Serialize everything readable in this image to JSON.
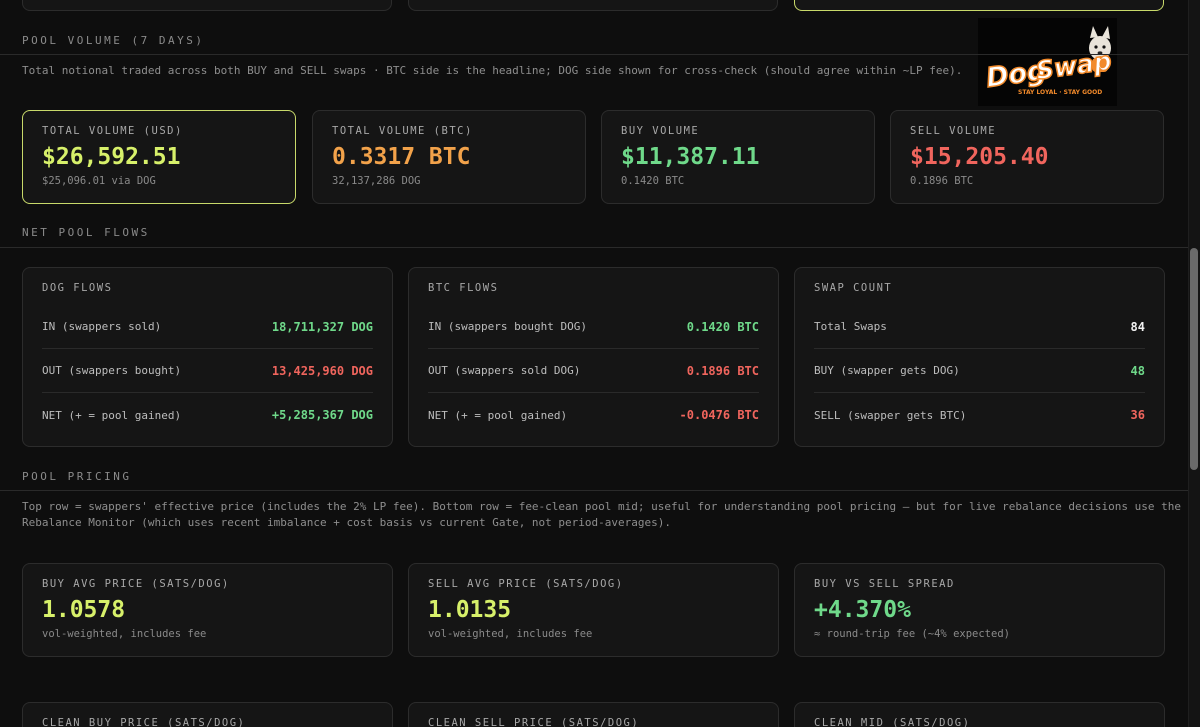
{
  "pool_volume": {
    "title": "POOL VOLUME (7 DAYS)",
    "description": "Total notional traded across both BUY and SELL swaps · BTC side is the headline; DOG side shown for cross-check (should agree within ~LP fee).",
    "cards": [
      {
        "label": "TOTAL VOLUME (USD)",
        "value": "$26,592.51",
        "sub": "$25,096.01 via DOG"
      },
      {
        "label": "TOTAL VOLUME (BTC)",
        "value": "0.3317 BTC",
        "sub": "32,137,286 DOG"
      },
      {
        "label": "BUY VOLUME",
        "value": "$11,387.11",
        "sub": "0.1420 BTC"
      },
      {
        "label": "SELL VOLUME",
        "value": "$15,205.40",
        "sub": "0.1896 BTC"
      }
    ]
  },
  "net_flows": {
    "title": "NET POOL FLOWS",
    "dog": {
      "title": "DOG FLOWS",
      "rows": [
        {
          "label": "IN (swappers sold)",
          "value": "18,711,327 DOG"
        },
        {
          "label": "OUT (swappers bought)",
          "value": "13,425,960 DOG"
        },
        {
          "label": "NET (+ = pool gained)",
          "value": "+5,285,367 DOG"
        }
      ]
    },
    "btc": {
      "title": "BTC FLOWS",
      "rows": [
        {
          "label": "IN (swappers bought DOG)",
          "value": "0.1420 BTC"
        },
        {
          "label": "OUT (swappers sold DOG)",
          "value": "0.1896 BTC"
        },
        {
          "label": "NET (+ = pool gained)",
          "value": "-0.0476 BTC"
        }
      ]
    },
    "count": {
      "title": "SWAP COUNT",
      "rows": [
        {
          "label": "Total Swaps",
          "value": "84"
        },
        {
          "label": "BUY (swapper gets DOG)",
          "value": "48"
        },
        {
          "label": "SELL (swapper gets BTC)",
          "value": "36"
        }
      ]
    }
  },
  "pricing": {
    "title": "POOL PRICING",
    "description_1": "Top row = swappers' effective price (includes the 2% LP fee). Bottom row = fee-clean pool mid; useful for understanding pool pricing — but for live rebalance decisions use the",
    "description_2": "Rebalance Monitor (which uses recent imbalance + cost basis vs current Gate, not period-averages).",
    "cards": [
      {
        "label": "BUY AVG PRICE (SATS/DOG)",
        "value": "1.0578",
        "sub": "vol-weighted, includes fee"
      },
      {
        "label": "SELL AVG PRICE (SATS/DOG)",
        "value": "1.0135",
        "sub": "vol-weighted, includes fee"
      },
      {
        "label": "BUY VS SELL SPREAD",
        "value": "+4.370%",
        "sub": "≈ round-trip fee (~4% expected)"
      }
    ],
    "bottom_cards": [
      {
        "label": "CLEAN BUY PRICE (SATS/DOG)"
      },
      {
        "label": "CLEAN SELL PRICE (SATS/DOG)"
      },
      {
        "label": "CLEAN MID (SATS/DOG)"
      }
    ]
  },
  "logo": {
    "text": "DogSwap",
    "tagline": "STAY LOYAL · STAY GOOD"
  },
  "colors": {
    "accent": "#d7f06a",
    "btc": "#f2a24a",
    "positive": "#6fd98a",
    "negative": "#f0655d"
  }
}
